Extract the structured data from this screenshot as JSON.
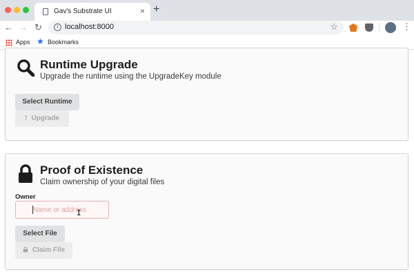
{
  "browser": {
    "tab_title": "Gav's Substrate UI",
    "tab_close": "×",
    "new_tab": "+",
    "url": "localhost:8000",
    "bookmarks": [
      {
        "label": "Apps",
        "icon": "apps-grid-icon"
      },
      {
        "label": "Bookmarks",
        "icon": "bookmark-star-icon"
      }
    ]
  },
  "runtime_upgrade": {
    "title": "Runtime Upgrade",
    "subtitle": "Upgrade the runtime using the UpgradeKey module",
    "icon": "search-icon",
    "select_button": "Select Runtime",
    "upgrade_button": "Upgrade",
    "upgrade_glyph": "!"
  },
  "proof_of_existence": {
    "title": "Proof of Existence",
    "subtitle": "Claim ownership of your digital files",
    "icon": "lock-icon",
    "owner_label": "Owner",
    "owner_placeholder": "Name or address",
    "owner_value": "",
    "select_button": "Select File",
    "claim_button": "Claim File"
  },
  "colors": {
    "input_error_bg": "#fff6f6",
    "input_error_border": "#e0b4b4",
    "button_bg": "#e0e1e2"
  }
}
